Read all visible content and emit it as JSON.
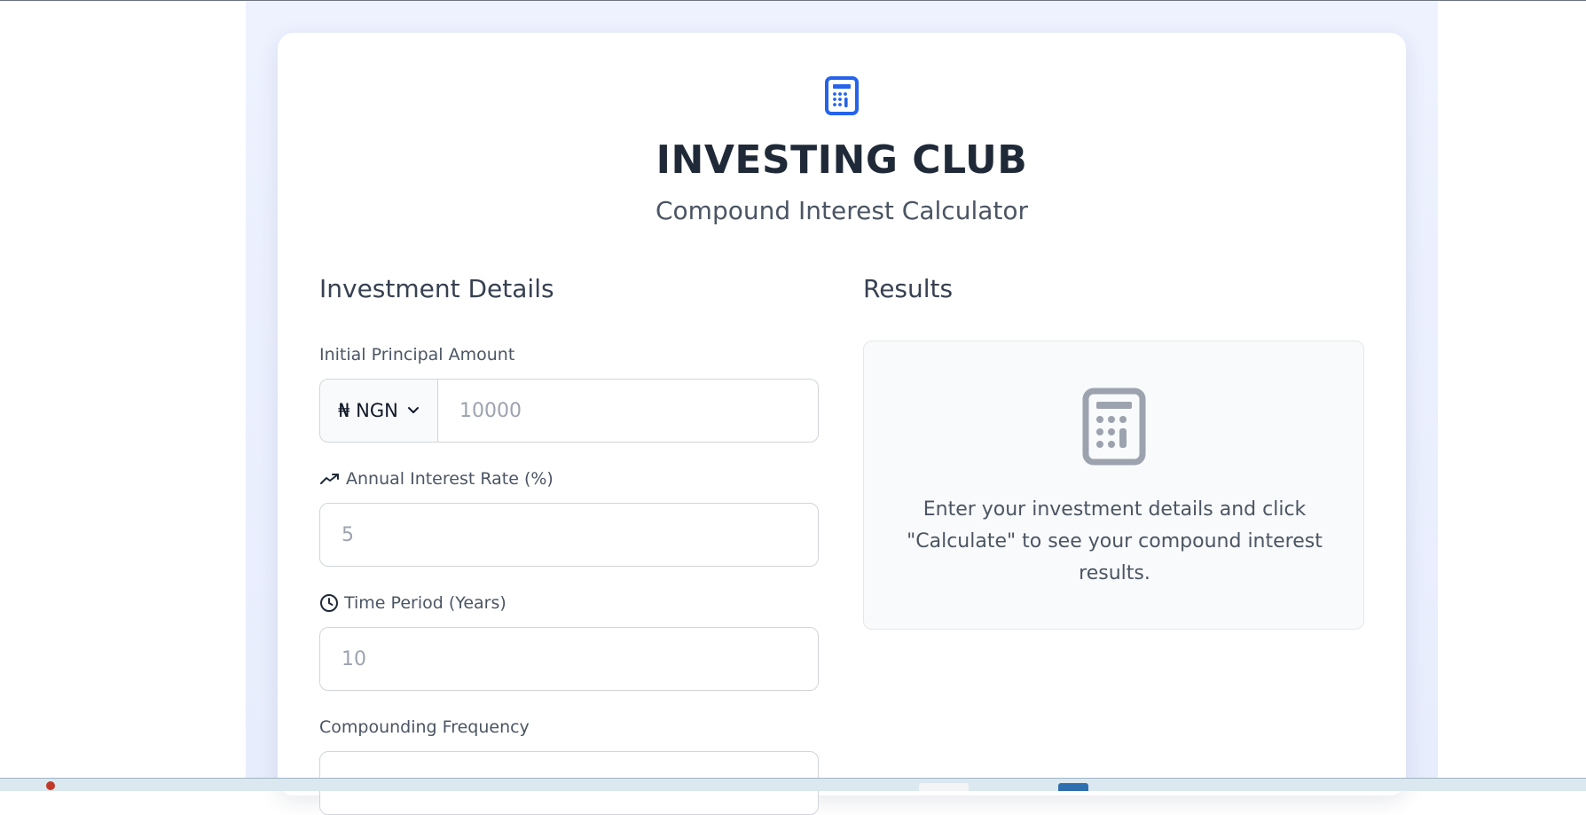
{
  "header": {
    "brand_title": "INVESTING CLUB",
    "subtitle": "Compound Interest Calculator"
  },
  "form": {
    "heading": "Investment Details",
    "principal": {
      "label": "Initial Principal Amount",
      "currency": "₦ NGN",
      "placeholder": "10000"
    },
    "rate": {
      "label": "Annual Interest Rate (%)",
      "placeholder": "5"
    },
    "period": {
      "label": "Time Period (Years)",
      "placeholder": "10"
    },
    "frequency": {
      "label": "Compounding Frequency"
    }
  },
  "results": {
    "heading": "Results",
    "empty_message": "Enter your investment details and click \"Calculate\" to see your compound interest results."
  },
  "colors": {
    "accent": "#2563eb",
    "muted_icon": "#9ca3af",
    "backdrop": "#eef2ff"
  }
}
